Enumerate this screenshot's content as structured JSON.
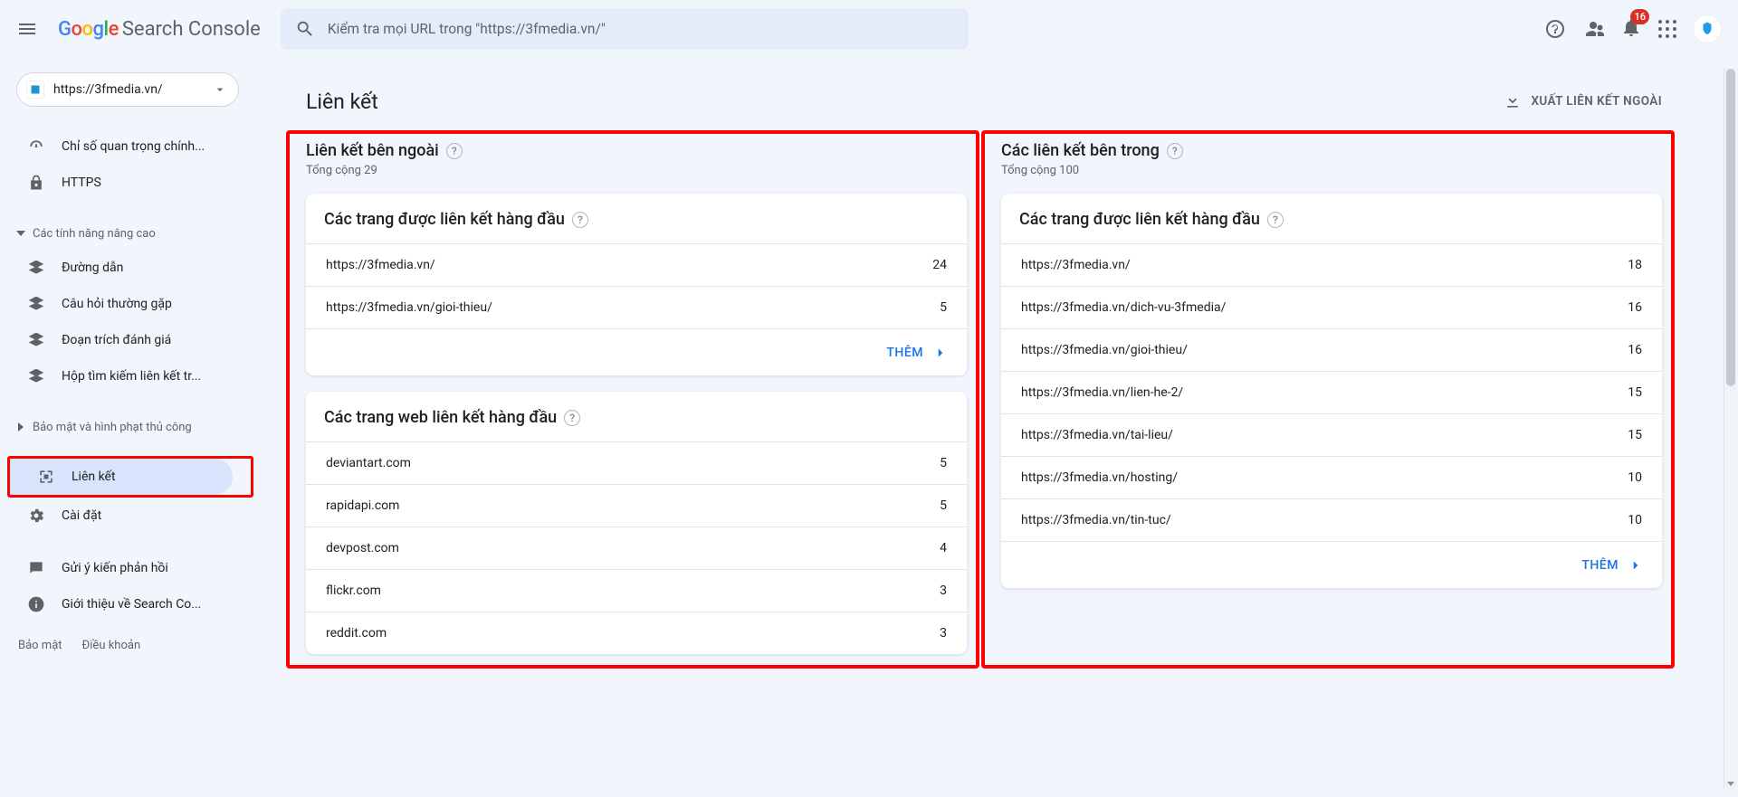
{
  "header": {
    "logo_product": "Search Console",
    "search_placeholder": "Kiểm tra mọi URL trong \"https://3fmedia.vn/\"",
    "notification_count": "16"
  },
  "sidebar": {
    "property_label": "https://3fmedia.vn/",
    "items": {
      "core_web_vitals": "Chỉ số quan trọng chính...",
      "https": "HTTPS",
      "advanced_group": "Các tính năng nâng cao",
      "breadcrumbs": "Đường dẫn",
      "faq": "Câu hỏi thường gặp",
      "review_snippet": "Đoạn trích đánh giá",
      "sitelinks_search": "Hộp tìm kiếm liên kết tr...",
      "security_group": "Bảo mật và hình phạt thủ công",
      "links": "Liên kết",
      "settings": "Cài đặt",
      "feedback": "Gửi ý kiến phản hồi",
      "about": "Giới thiệu về Search Co..."
    },
    "footer": {
      "privacy": "Bảo mật",
      "terms": "Điều khoản"
    }
  },
  "main": {
    "title": "Liên kết",
    "export_label": "XUẤT LIÊN KẾT NGOÀI",
    "more_label": "THÊM",
    "external": {
      "title": "Liên kết bên ngoài",
      "total": "Tổng cộng 29",
      "top_pages_title": "Các trang được liên kết hàng đầu",
      "top_pages": [
        {
          "url": "https://3fmedia.vn/",
          "count": "24"
        },
        {
          "url": "https://3fmedia.vn/gioi-thieu/",
          "count": "5"
        }
      ],
      "top_sites_title": "Các trang web liên kết hàng đầu",
      "top_sites": [
        {
          "url": "deviantart.com",
          "count": "5"
        },
        {
          "url": "rapidapi.com",
          "count": "5"
        },
        {
          "url": "devpost.com",
          "count": "4"
        },
        {
          "url": "flickr.com",
          "count": "3"
        },
        {
          "url": "reddit.com",
          "count": "3"
        }
      ]
    },
    "internal": {
      "title": "Các liên kết bên trong",
      "total": "Tổng cộng 100",
      "top_pages_title": "Các trang được liên kết hàng đầu",
      "top_pages": [
        {
          "url": "https://3fmedia.vn/",
          "count": "18"
        },
        {
          "url": "https://3fmedia.vn/dich-vu-3fmedia/",
          "count": "16"
        },
        {
          "url": "https://3fmedia.vn/gioi-thieu/",
          "count": "16"
        },
        {
          "url": "https://3fmedia.vn/lien-he-2/",
          "count": "15"
        },
        {
          "url": "https://3fmedia.vn/tai-lieu/",
          "count": "15"
        },
        {
          "url": "https://3fmedia.vn/hosting/",
          "count": "10"
        },
        {
          "url": "https://3fmedia.vn/tin-tuc/",
          "count": "10"
        }
      ]
    }
  }
}
